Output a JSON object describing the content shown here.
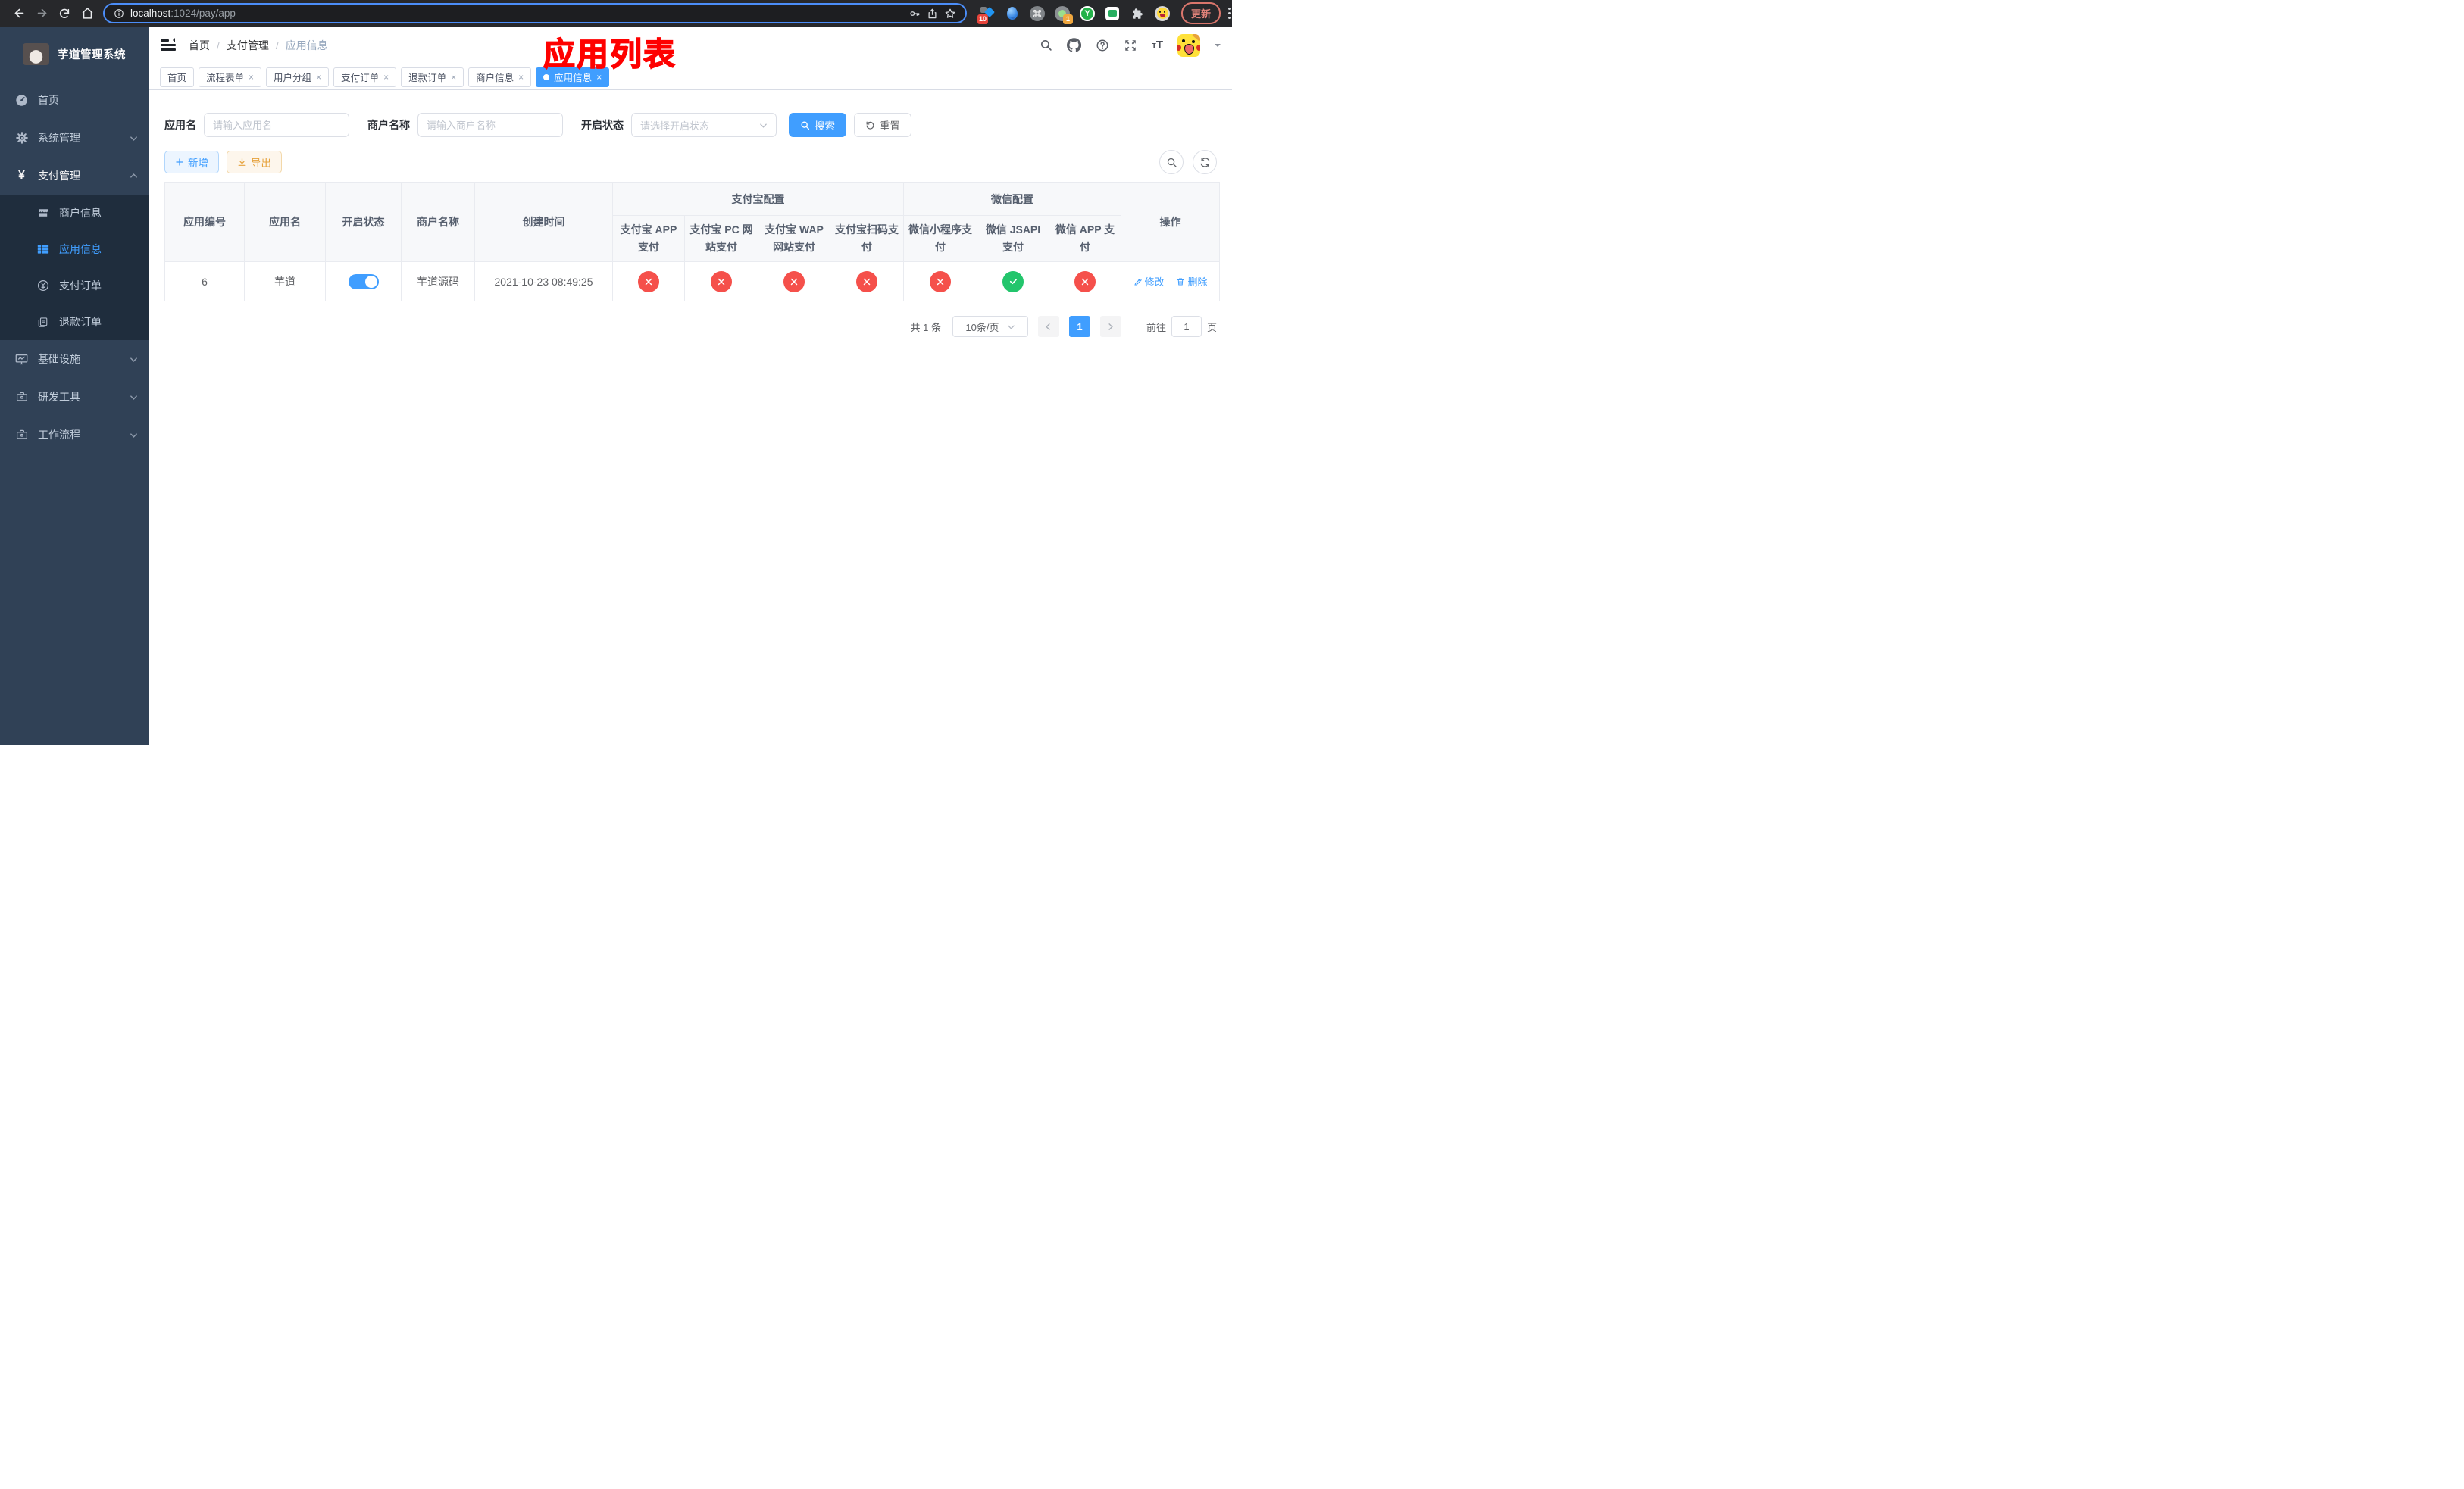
{
  "colors": {
    "accent": "#409eff",
    "success": "#23c56c",
    "danger": "#f5504b",
    "warning": "#e6a23c",
    "sidebar_bg": "#304156",
    "submenu_bg": "#1f2d3d",
    "title_red": "#fe0100"
  },
  "browser": {
    "url_host": "localhost",
    "url_rest": ":1024/pay/app",
    "update_label": "更新",
    "ext_badge_first": "10",
    "ext_badge_second": "1",
    "ext_y_letter": "Y"
  },
  "sidebar": {
    "title": "芋道管理系统",
    "items": [
      {
        "label": "首页",
        "icon": "dashboard-icon"
      },
      {
        "label": "系统管理",
        "icon": "gear-icon",
        "chevron": "down"
      },
      {
        "label": "支付管理",
        "icon": "yen-icon",
        "chevron": "up",
        "expanded": true
      },
      {
        "label": "基础设施",
        "icon": "monitor-icon",
        "chevron": "down"
      },
      {
        "label": "研发工具",
        "icon": "toolbox-icon",
        "chevron": "down"
      },
      {
        "label": "工作流程",
        "icon": "briefcase-icon",
        "chevron": "down"
      }
    ],
    "payment_children": [
      {
        "label": "商户信息",
        "icon": "storefront-icon"
      },
      {
        "label": "应用信息",
        "icon": "grid-icon",
        "active": true
      },
      {
        "label": "支付订单",
        "icon": "yen-circle-icon"
      },
      {
        "label": "退款订单",
        "icon": "document-icon"
      }
    ]
  },
  "header": {
    "breadcrumb": [
      "首页",
      "支付管理",
      "应用信息"
    ],
    "overlay_title": "应用列表"
  },
  "tabs": {
    "items": [
      {
        "label": "首页",
        "closable": false
      },
      {
        "label": "流程表单",
        "closable": true
      },
      {
        "label": "用户分组",
        "closable": true
      },
      {
        "label": "支付订单",
        "closable": true
      },
      {
        "label": "退款订单",
        "closable": true
      },
      {
        "label": "商户信息",
        "closable": true
      },
      {
        "label": "应用信息",
        "closable": true,
        "active": true
      }
    ]
  },
  "filters": {
    "app_name_label": "应用名",
    "app_name_placeholder": "请输入应用名",
    "merchant_label": "商户名称",
    "merchant_placeholder": "请输入商户名称",
    "status_label": "开启状态",
    "status_placeholder": "请选择开启状态",
    "search_label": "搜索",
    "reset_label": "重置"
  },
  "toolbar": {
    "add_label": "新增",
    "export_label": "导出"
  },
  "table": {
    "groups": {
      "alipay": "支付宝配置",
      "wechat": "微信配置"
    },
    "columns": [
      "应用编号",
      "应用名",
      "开启状态",
      "商户名称",
      "创建时间",
      "支付宝 APP 支付",
      "支付宝 PC 网站支付",
      "支付宝 WAP 网站支付",
      "支付宝扫码支付",
      "微信小程序支付",
      "微信 JSAPI 支付",
      "微信 APP 支付",
      "操作"
    ],
    "rows": [
      {
        "id": "6",
        "app_name": "芋道",
        "enabled": "on",
        "merchant_name": "芋道源码",
        "created_at": "2021-10-23 08:49:25",
        "statuses": [
          "fail",
          "fail",
          "fail",
          "fail",
          "fail",
          "success",
          "fail"
        ],
        "edit_label": "修改",
        "delete_label": "删除"
      }
    ]
  },
  "pagination": {
    "total": "共 1 条",
    "page_size": "10条/页",
    "current_page": "1",
    "goto_label": "前往",
    "goto_value": "1",
    "unit_label": "页"
  }
}
